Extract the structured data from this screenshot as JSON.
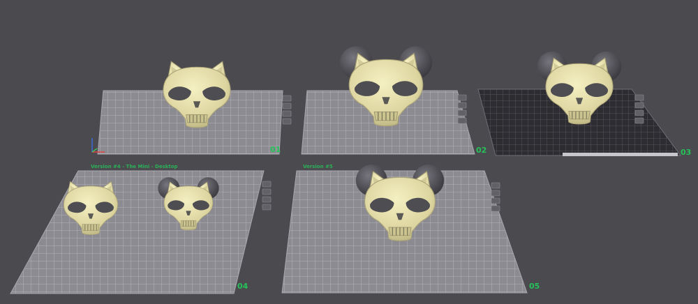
{
  "workspace": {
    "background": "#4b4a4f",
    "accent": "#25c35a",
    "mask_color": "#e8e2a9",
    "ear_cup_color": "#5a585e"
  },
  "plates": [
    {
      "number": "01",
      "label": "",
      "selected": false
    },
    {
      "number": "02",
      "label": "",
      "selected": false
    },
    {
      "number": "03",
      "label": "",
      "selected": true
    },
    {
      "number": "04",
      "label": "Version #4 - The Mini - Desktop",
      "selected": false
    },
    {
      "number": "05",
      "label": "Version #5",
      "selected": false
    }
  ],
  "icons": {
    "axis_gizmo": "xyz-axis-icon",
    "plate_tool": "plate-tool-icon",
    "model": "cat-skull-mask-model"
  }
}
